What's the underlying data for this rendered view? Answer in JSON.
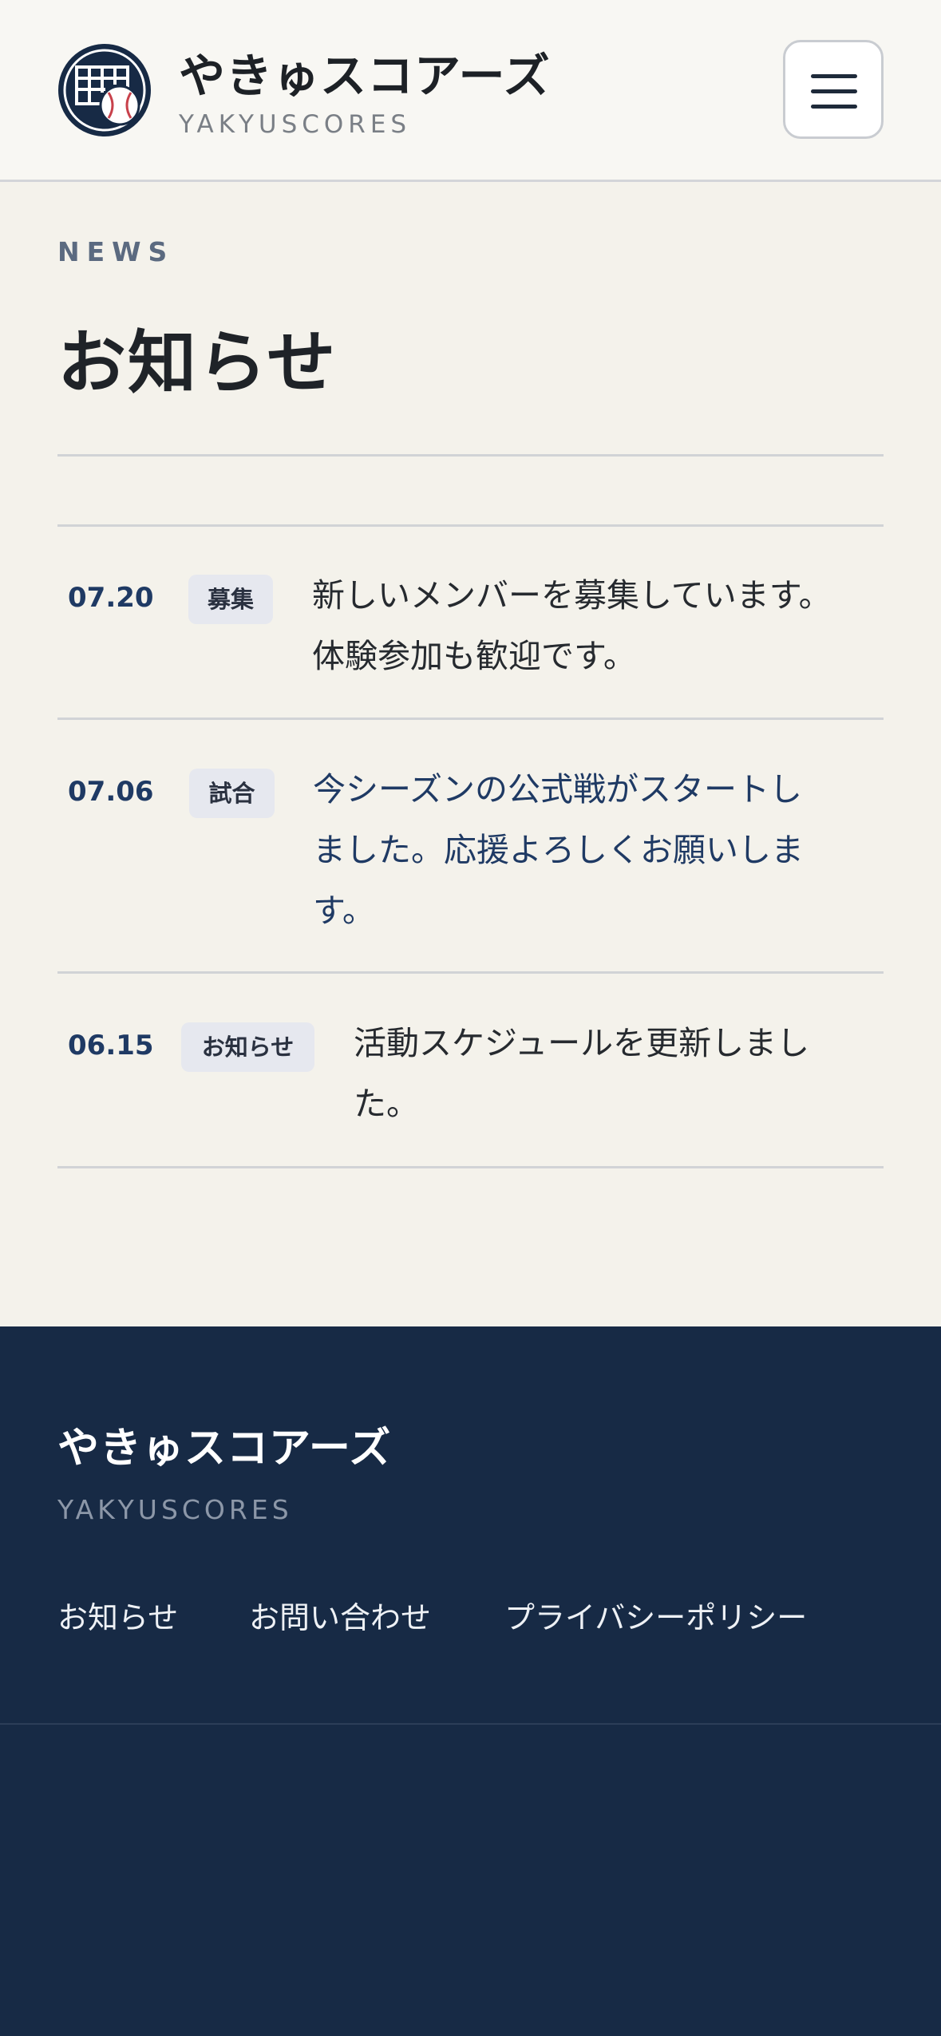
{
  "header": {
    "brand_name": "やきゅスコアーズ",
    "brand_sub": "YAKYUSCORES",
    "logo_icon": "scoreboard-baseball-icon",
    "menu_icon": "hamburger-icon"
  },
  "page": {
    "eyebrow": "NEWS",
    "title": "お知らせ"
  },
  "news": [
    {
      "date": "07.20",
      "tag": "募集",
      "lines": [
        "新しいメンバーを募集しています。",
        "体験参加も歓迎です。"
      ]
    },
    {
      "date": "07.06",
      "tag": "試合",
      "lines": [
        "今シーズンの公式戦がスタートし",
        "ました。応援よろしくお願いしま",
        "す。"
      ]
    },
    {
      "date": "06.15",
      "tag": "お知らせ",
      "lines": [
        "活動スケジュールを更新しまし",
        "た。"
      ]
    }
  ],
  "footer": {
    "brand_name": "やきゅスコアーズ",
    "brand_sub": "YAKYUSCORES",
    "links": [
      "お知らせ",
      "お問い合わせ",
      "プライバシーポリシー"
    ]
  },
  "colors": {
    "navy": "#172a45",
    "accent_red": "#c8414b",
    "tag_bg": "#e6e8ef",
    "page_bg": "#f4f2eb"
  }
}
